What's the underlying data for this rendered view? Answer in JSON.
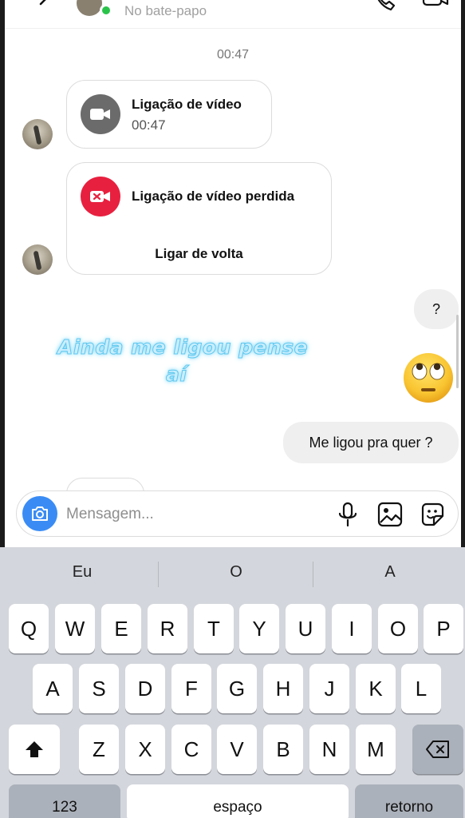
{
  "header": {
    "status": "No bate-papo"
  },
  "chat": {
    "timestamp": "00:47",
    "video_call": {
      "title": "Ligação de vídeo",
      "duration": "00:47"
    },
    "missed_call": {
      "title": "Ligação de vídeo perdida",
      "action": "Ligar de volta"
    },
    "messages": [
      {
        "text": "?"
      },
      {
        "text": "Me ligou pra quer ?"
      }
    ],
    "overlay_text": {
      "line1": "Ainda me ligou pense",
      "line2": "aí"
    },
    "emoji": "face-with-rolling-eyes"
  },
  "composer": {
    "placeholder": "Mensagem..."
  },
  "keyboard": {
    "suggestions": [
      "Eu",
      "O",
      "A"
    ],
    "row1": [
      "Q",
      "W",
      "E",
      "R",
      "T",
      "Y",
      "U",
      "I",
      "O",
      "P"
    ],
    "row2": [
      "A",
      "S",
      "D",
      "F",
      "G",
      "H",
      "J",
      "K",
      "L"
    ],
    "row3": [
      "Z",
      "X",
      "C",
      "V",
      "B",
      "N",
      "M"
    ],
    "numbers_label": "123",
    "space_label": "espaço",
    "return_label": "retorno"
  },
  "colors": {
    "online": "#2ac34a",
    "missed_call": "#e8203f",
    "camera_button": "#3a8cf4",
    "overlay_text": "#cbeeff"
  }
}
